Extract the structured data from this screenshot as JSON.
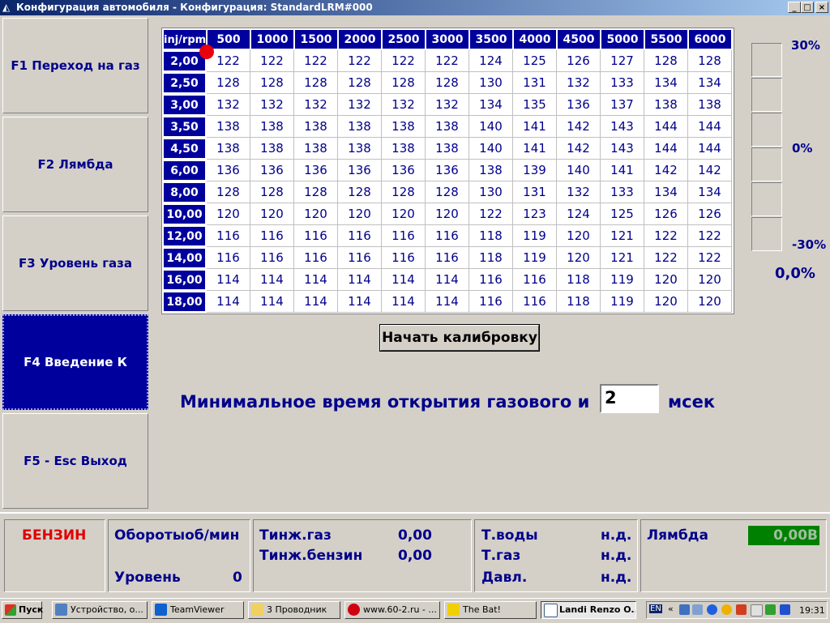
{
  "window": {
    "title": "Конфигурация автомобиля - Конфигурация: StandardLRM#000",
    "controls": [
      "_",
      "□",
      "×"
    ]
  },
  "sidebar": {
    "items": [
      {
        "label": "F1 Переход на газ",
        "active": false
      },
      {
        "label": "F2 Лямбда",
        "active": false
      },
      {
        "label": "F3 Уровень газа",
        "active": false
      },
      {
        "label": "F4 Введение К",
        "active": true
      },
      {
        "label": "F5 - Esc Выход",
        "active": false
      }
    ]
  },
  "table": {
    "corner": "inj/rpm",
    "columns": [
      "500",
      "1000",
      "1500",
      "2000",
      "2500",
      "3000",
      "3500",
      "4000",
      "4500",
      "5000",
      "5500",
      "6000"
    ],
    "rows": [
      {
        "label": "2,00",
        "values": [
          "122",
          "122",
          "122",
          "122",
          "122",
          "122",
          "124",
          "125",
          "126",
          "127",
          "128",
          "128"
        ]
      },
      {
        "label": "2,50",
        "values": [
          "128",
          "128",
          "128",
          "128",
          "128",
          "128",
          "130",
          "131",
          "132",
          "133",
          "134",
          "134"
        ]
      },
      {
        "label": "3,00",
        "values": [
          "132",
          "132",
          "132",
          "132",
          "132",
          "132",
          "134",
          "135",
          "136",
          "137",
          "138",
          "138"
        ]
      },
      {
        "label": "3,50",
        "values": [
          "138",
          "138",
          "138",
          "138",
          "138",
          "138",
          "140",
          "141",
          "142",
          "143",
          "144",
          "144"
        ]
      },
      {
        "label": "4,50",
        "values": [
          "138",
          "138",
          "138",
          "138",
          "138",
          "138",
          "140",
          "141",
          "142",
          "143",
          "144",
          "144"
        ]
      },
      {
        "label": "6,00",
        "values": [
          "136",
          "136",
          "136",
          "136",
          "136",
          "136",
          "138",
          "139",
          "140",
          "141",
          "142",
          "142"
        ]
      },
      {
        "label": "8,00",
        "values": [
          "128",
          "128",
          "128",
          "128",
          "128",
          "128",
          "130",
          "131",
          "132",
          "133",
          "134",
          "134"
        ]
      },
      {
        "label": "10,00",
        "values": [
          "120",
          "120",
          "120",
          "120",
          "120",
          "120",
          "122",
          "123",
          "124",
          "125",
          "126",
          "126"
        ]
      },
      {
        "label": "12,00",
        "values": [
          "116",
          "116",
          "116",
          "116",
          "116",
          "116",
          "118",
          "119",
          "120",
          "121",
          "122",
          "122"
        ]
      },
      {
        "label": "14,00",
        "values": [
          "116",
          "116",
          "116",
          "116",
          "116",
          "116",
          "118",
          "119",
          "120",
          "121",
          "122",
          "122"
        ]
      },
      {
        "label": "16,00",
        "values": [
          "114",
          "114",
          "114",
          "114",
          "114",
          "114",
          "116",
          "116",
          "118",
          "119",
          "120",
          "120"
        ]
      },
      {
        "label": "18,00",
        "values": [
          "114",
          "114",
          "114",
          "114",
          "114",
          "114",
          "116",
          "116",
          "118",
          "119",
          "120",
          "120"
        ]
      }
    ],
    "marker_color": "#e8000c"
  },
  "gauge": {
    "top_label": "30%",
    "mid_label": "0%",
    "bottom_label": "-30%",
    "value": "0,0%"
  },
  "calibration": {
    "button_label": "Начать калибровку"
  },
  "min_time": {
    "label": "Минимальное время открытия газового и",
    "value": "2",
    "unit": "мсек"
  },
  "status": {
    "fuel": "БЕНЗИН",
    "rpm_label": "Оборотыоб/мин",
    "level_label": "Уровень",
    "level_value": "0",
    "tinj_gas_label": "Тинж.газ",
    "tinj_gas_value": "0,00",
    "tinj_petrol_label": "Тинж.бензин",
    "tinj_petrol_value": "0,00",
    "t_water_label": "Т.воды",
    "t_water_value": "н.д.",
    "t_gas_label": "Т.газ",
    "t_gas_value": "н.д.",
    "pressure_label": "Давл.",
    "pressure_value": "н.д.",
    "lambda_label": "Лямбда",
    "lambda_value": "0,00В"
  },
  "taskbar": {
    "start_label": "Пуск",
    "items": [
      {
        "label": "Устройство, о...",
        "active": false
      },
      {
        "label": "TeamViewer",
        "active": false
      },
      {
        "label": "3 Проводник",
        "active": false
      },
      {
        "label": "www.60-2.ru - ...",
        "active": false
      },
      {
        "label": "The Bat!",
        "active": false
      },
      {
        "label": "Landi Renzo O...",
        "active": true
      }
    ],
    "lang": "EN",
    "clock": "19:31"
  }
}
